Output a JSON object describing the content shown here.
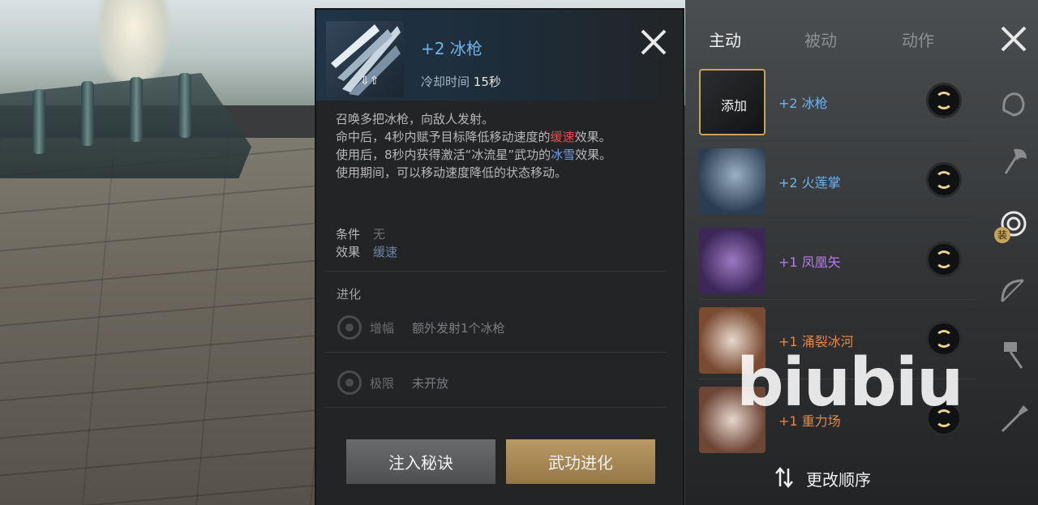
{
  "colors": {
    "accent_blue": "#6fb4ee",
    "rare_purple": "#b57bf0",
    "epic_orange": "#e0894b",
    "slow_red": "#e74a4a",
    "snow_blue": "#6f9ef0",
    "btn_gold": "#b99a63"
  },
  "detail": {
    "title": "+2 冰枪",
    "cooldown_label": "冷却时间",
    "cooldown_value": "15秒",
    "icon": "ice-spear-skill-icon",
    "desc_lines": [
      {
        "pre": "召唤多把冰枪，向敌人发射。",
        "hl": "",
        "post": ""
      },
      {
        "pre": "命中后，4秒内赋予目标降低移动速度的",
        "hl": "缓速",
        "post": "效果。"
      },
      {
        "pre": "使用后，8秒内获得激活“冰流星”武功的",
        "hl": "冰雪",
        "post": "效果。"
      },
      {
        "pre": "使用期间，可以移动速度降低的状态移动。",
        "hl": "",
        "post": ""
      }
    ],
    "condition_label": "条件",
    "condition_value": "无",
    "effect_label": "效果",
    "effect_value": "缓速",
    "evolution_title": "进化",
    "evolutions": [
      {
        "label": "增幅",
        "value": "额外发射1个冰枪"
      },
      {
        "label": "极限",
        "value": "未开放"
      }
    ],
    "buttons": {
      "inject": "注入秘诀",
      "evolve": "武功进化"
    }
  },
  "tabs": [
    {
      "label": "主动",
      "active": true
    },
    {
      "label": "被动",
      "active": false
    },
    {
      "label": "动作",
      "active": false
    }
  ],
  "skills": [
    {
      "name": "+2 冰枪",
      "color": "#6fb4ee",
      "selected": true,
      "overlay": "添加"
    },
    {
      "name": "+2 火莲掌",
      "color": "#6fb4ee",
      "selected": false,
      "overlay": ""
    },
    {
      "name": "+1 凤凰矢",
      "color": "#b57bf0",
      "selected": false,
      "overlay": ""
    },
    {
      "name": "+1 涌裂冰河",
      "color": "#e0894b",
      "selected": false,
      "overlay": ""
    },
    {
      "name": "+1 重力场",
      "color": "#e0894b",
      "selected": false,
      "overlay": ""
    }
  ],
  "reorder_label": "更改顺序",
  "categories": [
    {
      "icon": "fist-icon"
    },
    {
      "icon": "axe-icon"
    },
    {
      "icon": "swirl-orb-icon",
      "badge": "装"
    },
    {
      "icon": "bow-icon"
    },
    {
      "icon": "hammer-icon"
    },
    {
      "icon": "spear-icon"
    }
  ],
  "watermark": "biubiu"
}
